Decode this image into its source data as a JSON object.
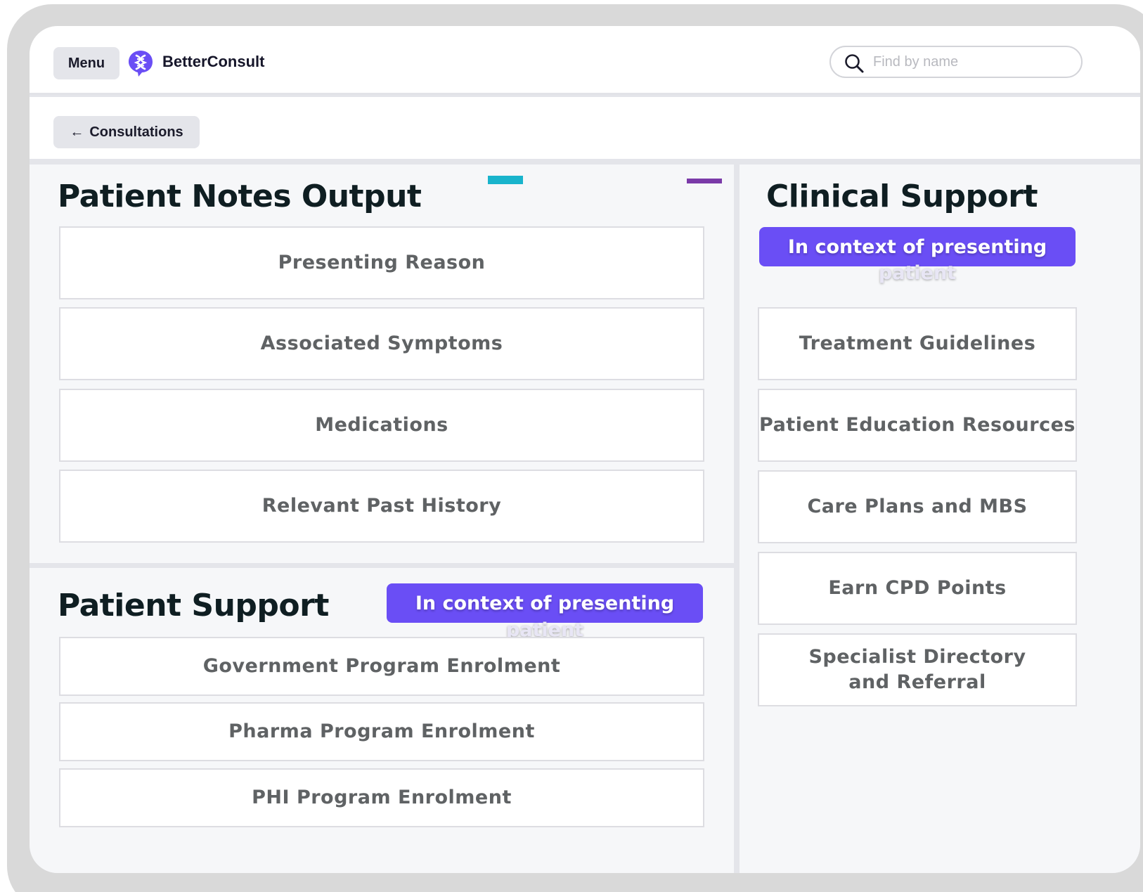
{
  "header": {
    "menu_label": "Menu",
    "brand": "BetterConsult",
    "search_placeholder": "Find by name"
  },
  "subheader": {
    "back_label": "Consultations",
    "back_arrow": "←"
  },
  "patient_notes": {
    "title": "Patient Notes Output",
    "items": [
      "Presenting Reason",
      "Associated Symptoms",
      "Medications",
      "Relevant Past History"
    ]
  },
  "patient_support": {
    "title": "Patient Support",
    "badge_line1": "In context of presenting",
    "badge_line2": "patient",
    "items": [
      "Government Program Enrolment",
      "Pharma Program Enrolment",
      "PHI Program Enrolment"
    ]
  },
  "clinical_support": {
    "title": "Clinical Support",
    "badge_line1": "In context of presenting",
    "badge_line2": "patient",
    "items": [
      "Treatment Guidelines",
      "Patient Education Resources",
      "Care Plans and MBS",
      "Earn CPD Points",
      "Specialist Directory and Referral"
    ]
  },
  "colors": {
    "accent": "#6a4ef5",
    "teal": "#19b4cc",
    "purple": "#7a3aa8"
  },
  "icons": {
    "logo": "brand-logo-icon",
    "search": "search-icon",
    "back": "arrow-left-icon"
  }
}
